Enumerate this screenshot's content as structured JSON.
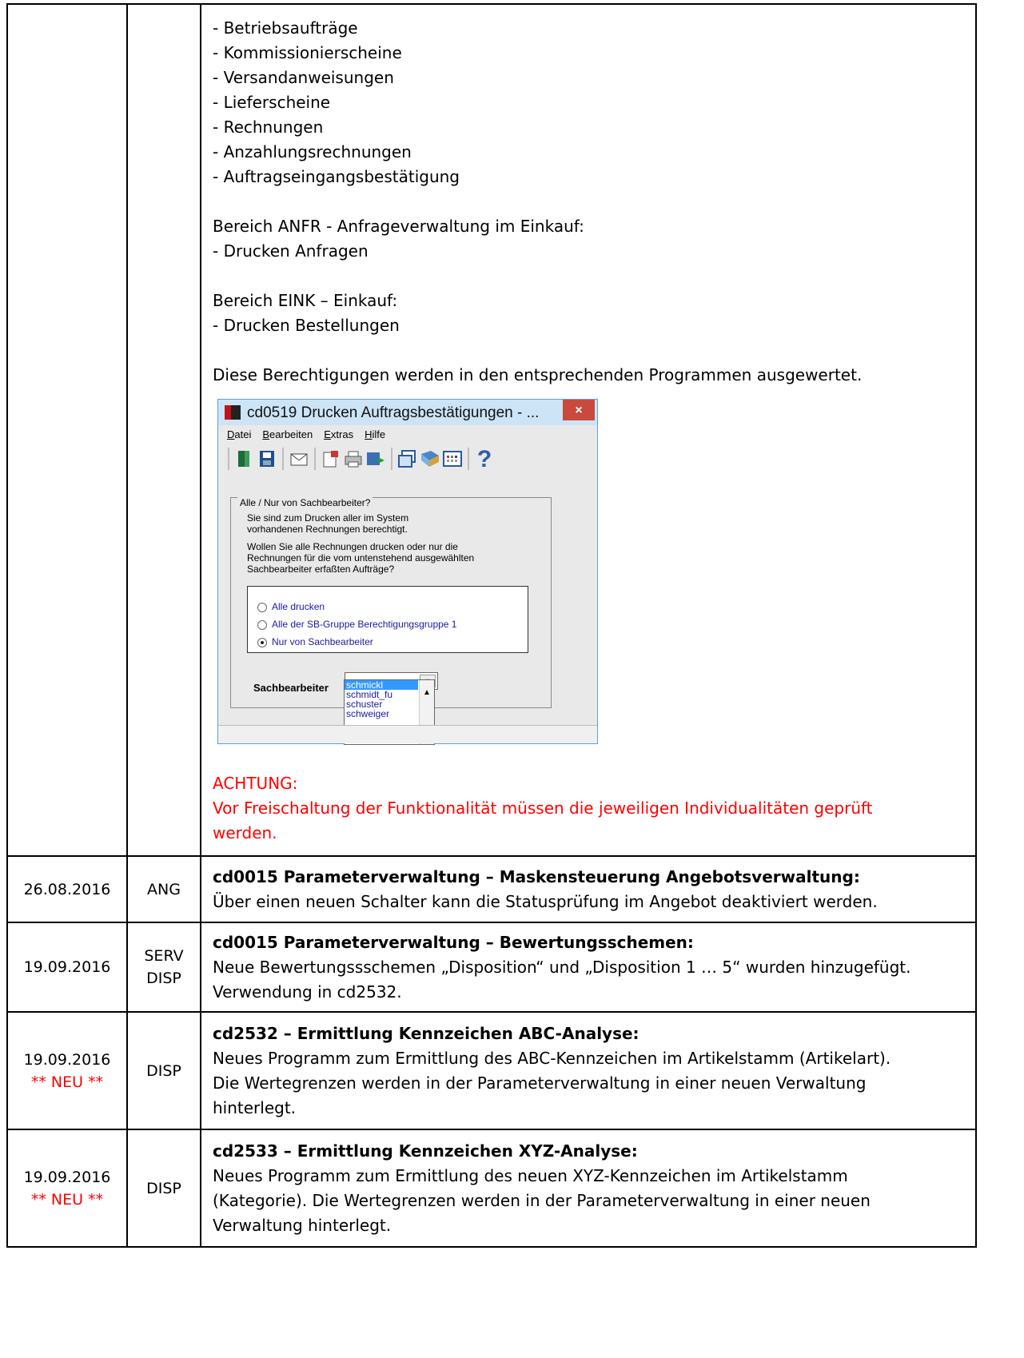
{
  "row1": {
    "lines": [
      "- Betriebsaufträge",
      "- Kommissionierscheine",
      "- Versandanweisungen",
      "- Lieferscheine",
      "- Rechnungen",
      "- Anzahlungsrechnungen",
      "- Auftragseingangsbestätigung"
    ],
    "anfr_heading": "Bereich ANFR - Anfrageverwaltung im Einkauf:",
    "anfr_item": "- Drucken Anfragen",
    "eink_heading": "Bereich EINK – Einkauf:",
    "eink_item": "- Drucken Bestellungen",
    "evaluation_note": "Diese Berechtigungen werden in den entsprechenden Programmen ausgewertet.",
    "warning_title": "ACHTUNG:",
    "warning_text": "Vor Freischaltung der Funktionalität müssen die jeweiligen Individualitäten geprüft werden."
  },
  "dialog": {
    "title": "cd0519 Drucken Auftragsbestätigungen - ...",
    "close_glyph": "×",
    "menu": [
      "Datei",
      "Bearbeiten",
      "Extras",
      "Hilfe"
    ],
    "toolbar_icons": [
      "exit-door-icon",
      "save-icon",
      "mail-icon",
      "properties-icon",
      "print-icon",
      "export-icon",
      "windows-icon",
      "book-icon",
      "calculator-icon",
      "help-icon"
    ],
    "help_glyph": "?",
    "group_label": "Alle / Nur von Sachbearbeiter?",
    "info_line1": "Sie sind zum Drucken aller im System",
    "info_line2": "vorhandenen Rechnungen berechtigt.",
    "question_line1": "Wollen Sie alle Rechnungen drucken oder nur die",
    "question_line2": "Rechnungen für die vom untenstehend ausgewählten",
    "question_line3": "Sachbearbeiter erfaßten Aufträge?",
    "radio_options": [
      "Alle drucken",
      "Alle der SB-Gruppe Berechtigungsgruppe 1",
      "Nur von Sachbearbeiter"
    ],
    "radio_selected_index": 2,
    "clerk_label": "Sachbearbeiter",
    "clerk_value": "schmickl",
    "clerk_options": [
      "schmickl",
      "schmidt_fu",
      "schuster",
      "schweiger"
    ]
  },
  "rows": [
    {
      "date": "26.08.2016",
      "date_note": "",
      "area": [
        "ANG"
      ],
      "title": "cd0015 Parameterverwaltung – Maskensteuerung Angebotsverwaltung:",
      "text": [
        "Über einen neuen Schalter kann die Statusprüfung im Angebot deaktiviert werden."
      ]
    },
    {
      "date": "19.09.2016",
      "date_note": "",
      "area": [
        "SERV",
        "DISP"
      ],
      "title": "cd0015 Parameterverwaltung – Bewertungsschemen:",
      "text": [
        "Neue Bewertungssschemen „Disposition“ und „Disposition 1 … 5“ wurden hinzugefügt.",
        "Verwendung in cd2532."
      ]
    },
    {
      "date": "19.09.2016",
      "date_note": "** NEU **",
      "area": [
        "DISP"
      ],
      "title": "cd2532 – Ermittlung Kennzeichen ABC-Analyse:",
      "text": [
        "Neues Programm zum Ermittlung des ABC-Kennzeichen im Artikelstamm (Artikelart).",
        "Die Wertegrenzen werden in der Parameterverwaltung in einer neuen Verwaltung",
        "hinterlegt."
      ]
    },
    {
      "date": "19.09.2016",
      "date_note": "** NEU **",
      "area": [
        "DISP"
      ],
      "title": "cd2533 – Ermittlung Kennzeichen XYZ-Analyse:",
      "text": [
        "Neues Programm zum Ermittlung des neuen XYZ-Kennzeichen im Artikelstamm",
        "(Kategorie). Die Wertegrenzen werden in der Parameterverwaltung in einer neuen",
        "Verwaltung hinterlegt."
      ]
    }
  ]
}
